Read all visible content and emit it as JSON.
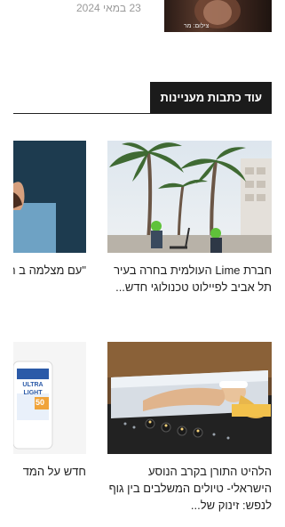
{
  "top": {
    "date": "23 במאי 2024",
    "thumb_caption": "צילום: מר"
  },
  "section": {
    "title": "עוד כתבות מעניינות"
  },
  "articles": [
    {
      "title": "חברת Lime העולמית בחרה בעיר תל אביב לפיילוט טכנולוגי חדש..."
    },
    {
      "title": "\"עם מצלמה ב הגב, הייתי הו"
    },
    {
      "title": "הלהיט התורן בקרב הנוסע הישראלי- טיולים המשלבים בין גוף לנפש: זינוק של..."
    },
    {
      "title": "חדש על המד"
    }
  ],
  "product": {
    "brand": "ULTRA LIGHT",
    "spf": "50"
  }
}
